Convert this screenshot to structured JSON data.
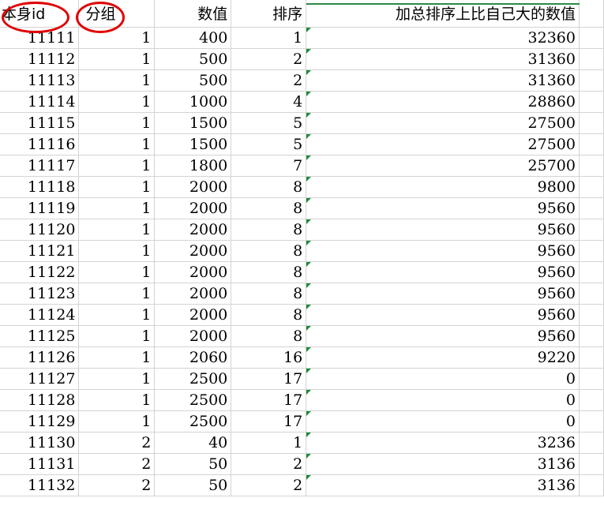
{
  "headers": {
    "id": "本身id",
    "group": "分组",
    "value": "数值",
    "rank": "排序",
    "sum": "加总排序上比自己大的数值"
  },
  "rows": [
    {
      "id": "11111",
      "group": "1",
      "value": "400",
      "rank": "1",
      "sum": "32360"
    },
    {
      "id": "11112",
      "group": "1",
      "value": "500",
      "rank": "2",
      "sum": "31360"
    },
    {
      "id": "11113",
      "group": "1",
      "value": "500",
      "rank": "2",
      "sum": "31360"
    },
    {
      "id": "11114",
      "group": "1",
      "value": "1000",
      "rank": "4",
      "sum": "28860"
    },
    {
      "id": "11115",
      "group": "1",
      "value": "1500",
      "rank": "5",
      "sum": "27500"
    },
    {
      "id": "11116",
      "group": "1",
      "value": "1500",
      "rank": "5",
      "sum": "27500"
    },
    {
      "id": "11117",
      "group": "1",
      "value": "1800",
      "rank": "7",
      "sum": "25700"
    },
    {
      "id": "11118",
      "group": "1",
      "value": "2000",
      "rank": "8",
      "sum": "9800"
    },
    {
      "id": "11119",
      "group": "1",
      "value": "2000",
      "rank": "8",
      "sum": "9560"
    },
    {
      "id": "11120",
      "group": "1",
      "value": "2000",
      "rank": "8",
      "sum": "9560"
    },
    {
      "id": "11121",
      "group": "1",
      "value": "2000",
      "rank": "8",
      "sum": "9560"
    },
    {
      "id": "11122",
      "group": "1",
      "value": "2000",
      "rank": "8",
      "sum": "9560"
    },
    {
      "id": "11123",
      "group": "1",
      "value": "2000",
      "rank": "8",
      "sum": "9560"
    },
    {
      "id": "11124",
      "group": "1",
      "value": "2000",
      "rank": "8",
      "sum": "9560"
    },
    {
      "id": "11125",
      "group": "1",
      "value": "2000",
      "rank": "8",
      "sum": "9560"
    },
    {
      "id": "11126",
      "group": "1",
      "value": "2060",
      "rank": "16",
      "sum": "9220"
    },
    {
      "id": "11127",
      "group": "1",
      "value": "2500",
      "rank": "17",
      "sum": "0"
    },
    {
      "id": "11128",
      "group": "1",
      "value": "2500",
      "rank": "17",
      "sum": "0"
    },
    {
      "id": "11129",
      "group": "1",
      "value": "2500",
      "rank": "17",
      "sum": "0"
    },
    {
      "id": "11130",
      "group": "2",
      "value": "40",
      "rank": "1",
      "sum": "3236"
    },
    {
      "id": "11131",
      "group": "2",
      "value": "50",
      "rank": "2",
      "sum": "3136"
    },
    {
      "id": "11132",
      "group": "2",
      "value": "50",
      "rank": "2",
      "sum": "3136"
    }
  ],
  "highlight_color": "#e00000",
  "error_flag_color": "#1e8c3a"
}
